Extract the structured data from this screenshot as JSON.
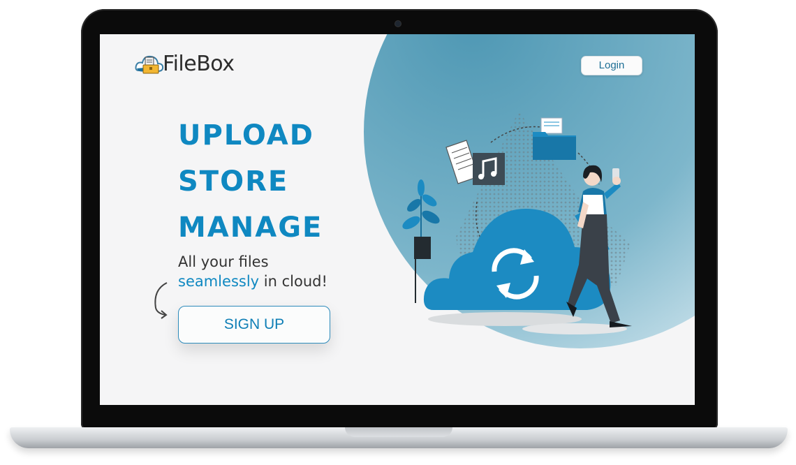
{
  "brand": {
    "name": "FileBox"
  },
  "nav": {
    "login_label": "Login"
  },
  "hero": {
    "headlines": [
      "UPLOAD",
      "STORE",
      "MANAGE"
    ],
    "tagline_line1": "All your files",
    "tagline_accent": "seamlessly",
    "tagline_rest": " in cloud!",
    "cta_label": "SIGN UP"
  },
  "colors": {
    "accent": "#0f88c1",
    "blob": "#4f98b4",
    "frame": "#0b0b0b"
  },
  "icons": [
    "cloud-logo-icon",
    "sync-icon",
    "music-note-icon",
    "folder-icon",
    "document-icon",
    "plant-icon",
    "curved-arrow-icon"
  ]
}
